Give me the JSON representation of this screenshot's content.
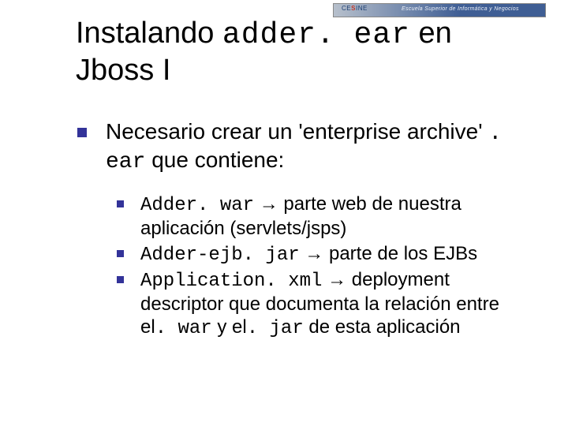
{
  "banner": {
    "logo_left": "CE",
    "logo_accent": "S",
    "logo_right": "INE",
    "tagline": "Escuela Superior de Informática y Negocios"
  },
  "title": {
    "pre": "Instalando ",
    "code": "adder. ear",
    "post": " en Jboss I"
  },
  "main": {
    "pre": "Necesario crear un 'enterprise archive' ",
    "code": ". ear",
    "post": " que contiene:"
  },
  "items": [
    {
      "code": "Adder. war",
      "arrow": " → ",
      "rest": "parte web de nuestra aplicación (servlets/jsps)"
    },
    {
      "code": "Adder-ejb. jar",
      "arrow": " → ",
      "rest": "parte de los EJBs"
    },
    {
      "code": "Application. xml",
      "arrow": " → ",
      "rest_pre": "deployment descriptor que documenta la relación entre el",
      "code2": ". war",
      "mid": " y el",
      "code3": ". jar",
      "rest_post": " de esta aplicación"
    }
  ]
}
